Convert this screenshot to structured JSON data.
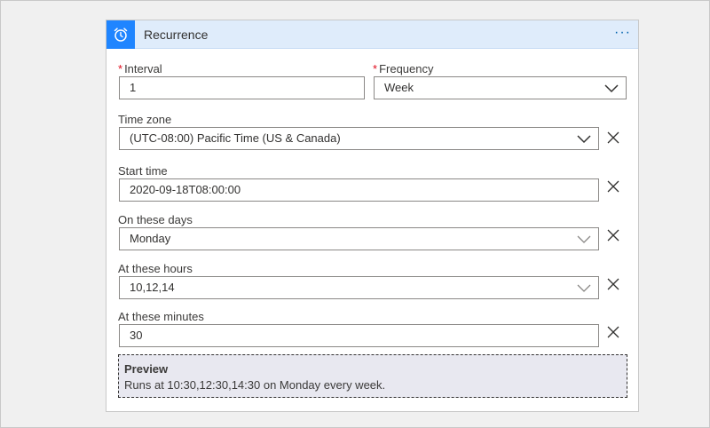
{
  "header": {
    "title": "Recurrence",
    "icon": "alarm-clock-icon",
    "more_label": "···",
    "accent": "#1f85ff"
  },
  "fields": {
    "interval": {
      "label": "Interval",
      "required": "*",
      "value": "1"
    },
    "frequency": {
      "label": "Frequency",
      "required": "*",
      "value": "Week"
    },
    "time_zone": {
      "label": "Time zone",
      "value": "(UTC-08:00) Pacific Time (US & Canada)"
    },
    "start_time": {
      "label": "Start time",
      "value": "2020-09-18T08:00:00"
    },
    "on_these_days": {
      "label": "On these days",
      "value": "Monday"
    },
    "at_these_hours": {
      "label": "At these hours",
      "value": "10,12,14"
    },
    "at_these_minutes": {
      "label": "At these minutes",
      "value": "30"
    }
  },
  "preview": {
    "title": "Preview",
    "text": "Runs at 10:30,12:30,14:30 on Monday every week."
  }
}
